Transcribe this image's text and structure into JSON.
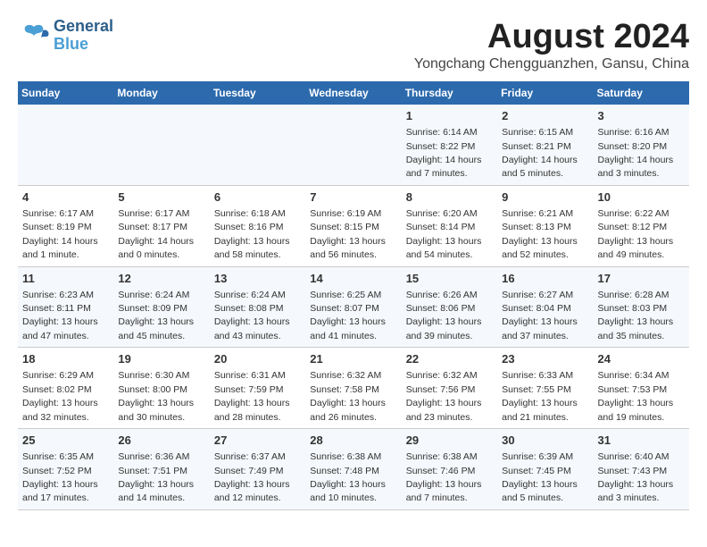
{
  "header": {
    "logo_general": "General",
    "logo_blue": "Blue",
    "month_title": "August 2024",
    "location": "Yongchang Chengguanzhen, Gansu, China"
  },
  "weekdays": [
    "Sunday",
    "Monday",
    "Tuesday",
    "Wednesday",
    "Thursday",
    "Friday",
    "Saturday"
  ],
  "weeks": [
    [
      {
        "day": "",
        "info": ""
      },
      {
        "day": "",
        "info": ""
      },
      {
        "day": "",
        "info": ""
      },
      {
        "day": "",
        "info": ""
      },
      {
        "day": "1",
        "info": "Sunrise: 6:14 AM\nSunset: 8:22 PM\nDaylight: 14 hours\nand 7 minutes."
      },
      {
        "day": "2",
        "info": "Sunrise: 6:15 AM\nSunset: 8:21 PM\nDaylight: 14 hours\nand 5 minutes."
      },
      {
        "day": "3",
        "info": "Sunrise: 6:16 AM\nSunset: 8:20 PM\nDaylight: 14 hours\nand 3 minutes."
      }
    ],
    [
      {
        "day": "4",
        "info": "Sunrise: 6:17 AM\nSunset: 8:19 PM\nDaylight: 14 hours\nand 1 minute."
      },
      {
        "day": "5",
        "info": "Sunrise: 6:17 AM\nSunset: 8:17 PM\nDaylight: 14 hours\nand 0 minutes."
      },
      {
        "day": "6",
        "info": "Sunrise: 6:18 AM\nSunset: 8:16 PM\nDaylight: 13 hours\nand 58 minutes."
      },
      {
        "day": "7",
        "info": "Sunrise: 6:19 AM\nSunset: 8:15 PM\nDaylight: 13 hours\nand 56 minutes."
      },
      {
        "day": "8",
        "info": "Sunrise: 6:20 AM\nSunset: 8:14 PM\nDaylight: 13 hours\nand 54 minutes."
      },
      {
        "day": "9",
        "info": "Sunrise: 6:21 AM\nSunset: 8:13 PM\nDaylight: 13 hours\nand 52 minutes."
      },
      {
        "day": "10",
        "info": "Sunrise: 6:22 AM\nSunset: 8:12 PM\nDaylight: 13 hours\nand 49 minutes."
      }
    ],
    [
      {
        "day": "11",
        "info": "Sunrise: 6:23 AM\nSunset: 8:11 PM\nDaylight: 13 hours\nand 47 minutes."
      },
      {
        "day": "12",
        "info": "Sunrise: 6:24 AM\nSunset: 8:09 PM\nDaylight: 13 hours\nand 45 minutes."
      },
      {
        "day": "13",
        "info": "Sunrise: 6:24 AM\nSunset: 8:08 PM\nDaylight: 13 hours\nand 43 minutes."
      },
      {
        "day": "14",
        "info": "Sunrise: 6:25 AM\nSunset: 8:07 PM\nDaylight: 13 hours\nand 41 minutes."
      },
      {
        "day": "15",
        "info": "Sunrise: 6:26 AM\nSunset: 8:06 PM\nDaylight: 13 hours\nand 39 minutes."
      },
      {
        "day": "16",
        "info": "Sunrise: 6:27 AM\nSunset: 8:04 PM\nDaylight: 13 hours\nand 37 minutes."
      },
      {
        "day": "17",
        "info": "Sunrise: 6:28 AM\nSunset: 8:03 PM\nDaylight: 13 hours\nand 35 minutes."
      }
    ],
    [
      {
        "day": "18",
        "info": "Sunrise: 6:29 AM\nSunset: 8:02 PM\nDaylight: 13 hours\nand 32 minutes."
      },
      {
        "day": "19",
        "info": "Sunrise: 6:30 AM\nSunset: 8:00 PM\nDaylight: 13 hours\nand 30 minutes."
      },
      {
        "day": "20",
        "info": "Sunrise: 6:31 AM\nSunset: 7:59 PM\nDaylight: 13 hours\nand 28 minutes."
      },
      {
        "day": "21",
        "info": "Sunrise: 6:32 AM\nSunset: 7:58 PM\nDaylight: 13 hours\nand 26 minutes."
      },
      {
        "day": "22",
        "info": "Sunrise: 6:32 AM\nSunset: 7:56 PM\nDaylight: 13 hours\nand 23 minutes."
      },
      {
        "day": "23",
        "info": "Sunrise: 6:33 AM\nSunset: 7:55 PM\nDaylight: 13 hours\nand 21 minutes."
      },
      {
        "day": "24",
        "info": "Sunrise: 6:34 AM\nSunset: 7:53 PM\nDaylight: 13 hours\nand 19 minutes."
      }
    ],
    [
      {
        "day": "25",
        "info": "Sunrise: 6:35 AM\nSunset: 7:52 PM\nDaylight: 13 hours\nand 17 minutes."
      },
      {
        "day": "26",
        "info": "Sunrise: 6:36 AM\nSunset: 7:51 PM\nDaylight: 13 hours\nand 14 minutes."
      },
      {
        "day": "27",
        "info": "Sunrise: 6:37 AM\nSunset: 7:49 PM\nDaylight: 13 hours\nand 12 minutes."
      },
      {
        "day": "28",
        "info": "Sunrise: 6:38 AM\nSunset: 7:48 PM\nDaylight: 13 hours\nand 10 minutes."
      },
      {
        "day": "29",
        "info": "Sunrise: 6:38 AM\nSunset: 7:46 PM\nDaylight: 13 hours\nand 7 minutes."
      },
      {
        "day": "30",
        "info": "Sunrise: 6:39 AM\nSunset: 7:45 PM\nDaylight: 13 hours\nand 5 minutes."
      },
      {
        "day": "31",
        "info": "Sunrise: 6:40 AM\nSunset: 7:43 PM\nDaylight: 13 hours\nand 3 minutes."
      }
    ]
  ]
}
